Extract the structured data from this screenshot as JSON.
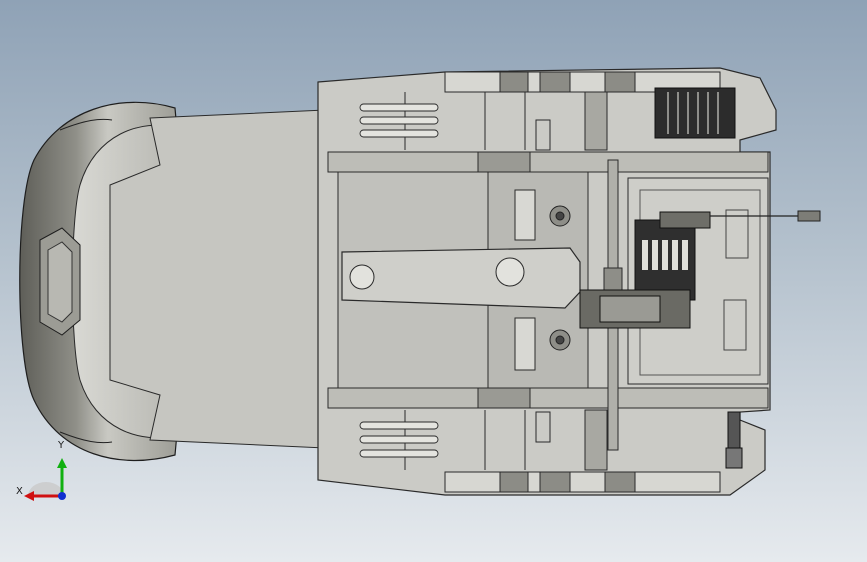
{
  "viewport": {
    "background_top": "#8fa2b6",
    "background_bottom": "#e6eaee",
    "model": {
      "description_icon": "cad-assembly-top-view",
      "body_fill": "#c9c9c4",
      "outline": "#2a2a2a",
      "hood_fill": "#7a7a74"
    }
  },
  "triad": {
    "x_label": "X",
    "y_label": "Y",
    "x_color": "#d01010",
    "y_color": "#10b010",
    "z_color": "#1030d0"
  }
}
